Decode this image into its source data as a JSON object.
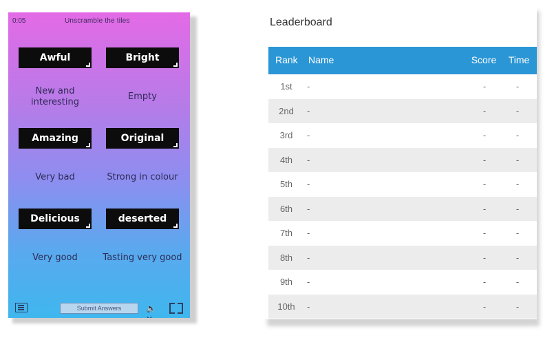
{
  "game": {
    "timer": "0:05",
    "instructions": "Unscramble the tiles",
    "tiles": [
      "Awful",
      "Bright",
      "Amazing",
      "Original",
      "Delicious",
      "deserted"
    ],
    "slots": [
      "New and interesting",
      "Empty",
      "Very bad",
      "Strong in colour",
      "Very good",
      "Tasting very good"
    ],
    "submit_label": "Submit Answers",
    "icons": {
      "menu": "menu-icon",
      "mute": "speaker-muted-icon",
      "fullscreen": "fullscreen-icon"
    }
  },
  "leaderboard": {
    "title": "Leaderboard",
    "header_color": "#2b96d6",
    "columns": [
      "Rank",
      "Name",
      "Score",
      "Time"
    ],
    "rows": [
      {
        "rank": "1st",
        "name": "-",
        "score": "-",
        "time": "-"
      },
      {
        "rank": "2nd",
        "name": "-",
        "score": "-",
        "time": "-"
      },
      {
        "rank": "3rd",
        "name": "-",
        "score": "-",
        "time": "-"
      },
      {
        "rank": "4th",
        "name": "-",
        "score": "-",
        "time": "-"
      },
      {
        "rank": "5th",
        "name": "-",
        "score": "-",
        "time": "-"
      },
      {
        "rank": "6th",
        "name": "-",
        "score": "-",
        "time": "-"
      },
      {
        "rank": "7th",
        "name": "-",
        "score": "-",
        "time": "-"
      },
      {
        "rank": "8th",
        "name": "-",
        "score": "-",
        "time": "-"
      },
      {
        "rank": "9th",
        "name": "-",
        "score": "-",
        "time": "-"
      },
      {
        "rank": "10th",
        "name": "-",
        "score": "-",
        "time": "-"
      }
    ]
  }
}
